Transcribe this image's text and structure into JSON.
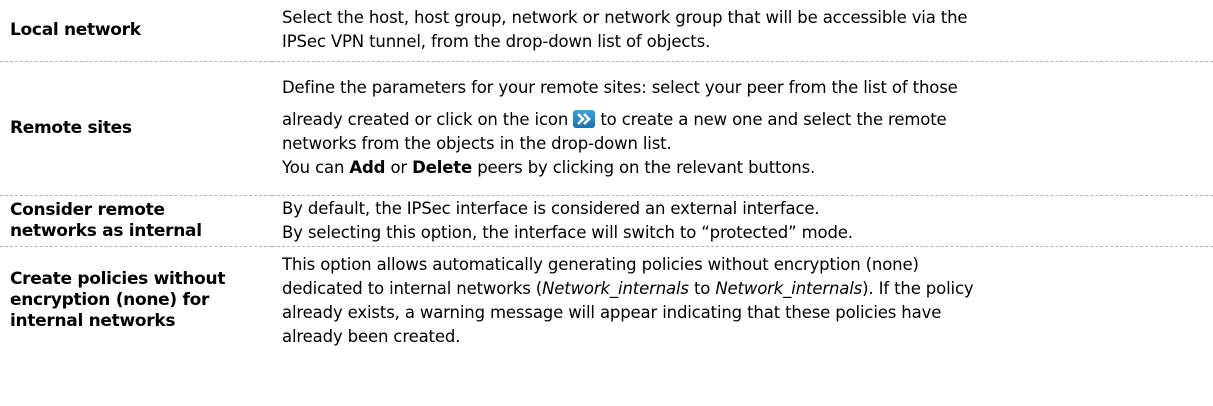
{
  "rows": [
    {
      "term": "Local network",
      "desc_lines": [
        "Select the host, host group, network or network group that will be accessible via the",
        "IPSec VPN tunnel, from the drop-down list of objects."
      ]
    },
    {
      "term": "Remote sites",
      "desc_line1": "Define the parameters for your remote sites: select your peer from the list of those",
      "desc_line2_a": "already created or click on the icon",
      "icon": "double-chevron-right-icon",
      "desc_line2_b": "to create a new one and select the remote",
      "desc_line3": "networks from the objects in the drop-down list.",
      "desc_line4_a": "You can",
      "add_label": "Add",
      "desc_line4_b": "or",
      "delete_label": "Delete",
      "desc_line4_c": "peers by clicking on the relevant buttons."
    },
    {
      "term_line1": "Consider remote",
      "term_line2": "networks as internal",
      "desc_lines": [
        "By default, the IPSec interface is considered an external interface.",
        "By selecting this option, the interface will switch to “protected” mode."
      ]
    },
    {
      "term_line1": "Create policies without",
      "term_line2": "encryption (none) for",
      "term_line3": "internal networks",
      "desc_line1": "This option allows automatically generating policies without encryption (none)",
      "desc_line2_a": "dedicated to internal networks (",
      "net_internals_1": "Network_internals",
      "desc_line2_b": "to",
      "net_internals_2": "Network_internals",
      "desc_line2_c": "). If the policy",
      "desc_line3": "already exists, a warning message will appear indicating that these policies have",
      "desc_line4": "already been created."
    }
  ]
}
